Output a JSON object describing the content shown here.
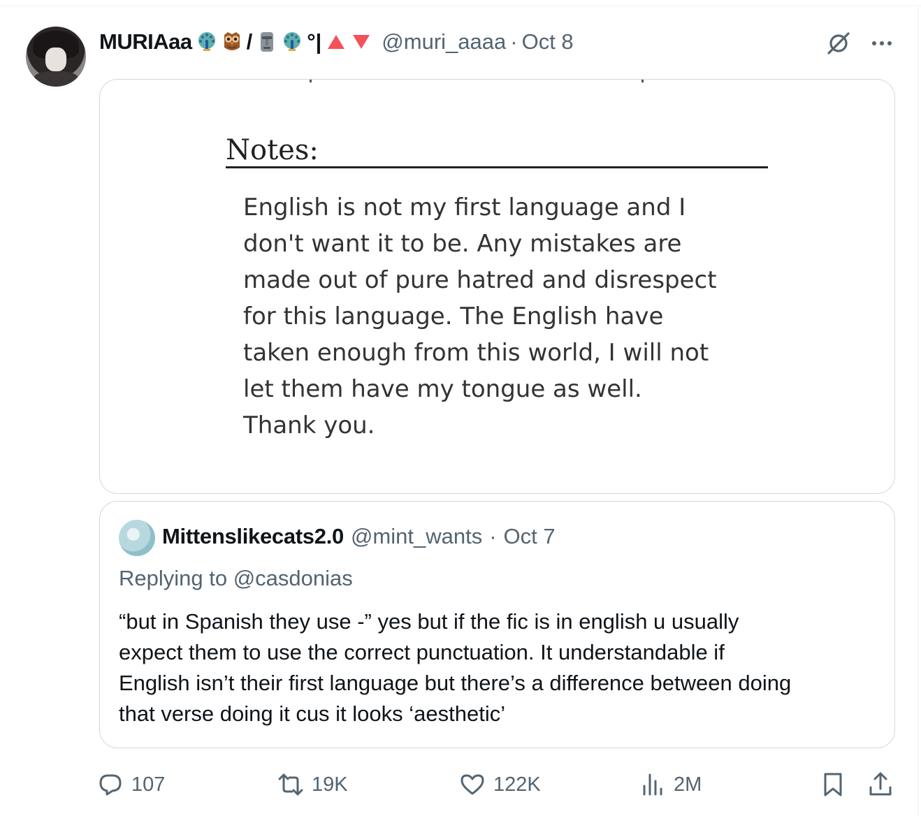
{
  "tweet": {
    "display_name": "MURIAaa",
    "name_suffix_emojis": [
      "peacock-emoji",
      "owl-emoji",
      "moai-emoji",
      "peacock-emoji"
    ],
    "name_separator": "/",
    "name_tail": "°|",
    "name_arrows": [
      "up-triangle",
      "down-triangle"
    ],
    "handle": "@muri_aaaa",
    "dot": "·",
    "date": "Oct 8",
    "image": {
      "heading": "Notes:",
      "lines": [
        "English is not my first language and I",
        "don't want it to be. Any mistakes are",
        "made out of pure hatred and disrespect",
        "for this language. The English have",
        "taken enough from this world, I will not",
        "let them have my tongue as well.",
        "Thank you."
      ]
    },
    "quoted": {
      "display_name": "Mittenslikecats2.0",
      "handle": "@mint_wants",
      "dot": "·",
      "date": "Oct 7",
      "replying_to": "Replying to @casdonias",
      "lines": [
        "“but in Spanish they use -” yes but if the fic is in english u usually",
        "expect them to use the correct punctuation. It understandable if",
        "English isn’t their first language but there’s a difference between doing",
        "that verse doing it cus it looks ‘aesthetic’"
      ]
    },
    "actions": {
      "replies": "107",
      "reposts": "19K",
      "likes": "122K",
      "views": "2M"
    }
  },
  "colors": {
    "text": "#0f1419",
    "secondary": "#536471",
    "border": "#cfd9de",
    "triangle": "#f4515a"
  }
}
